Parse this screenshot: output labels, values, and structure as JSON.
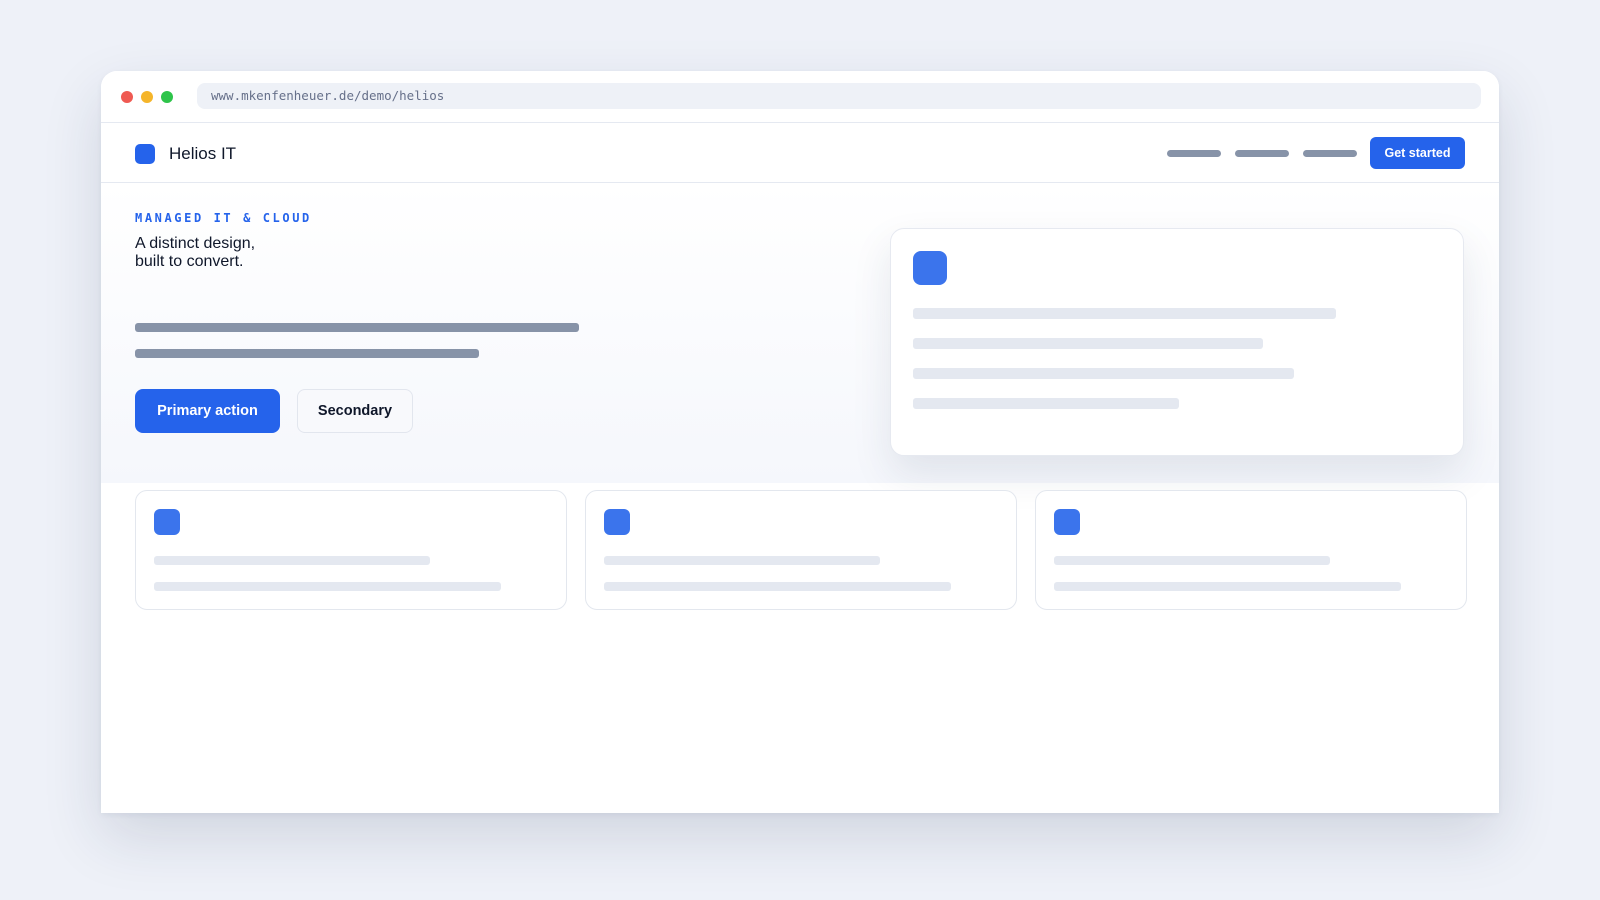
{
  "browser": {
    "url": "www.mkenfenheuer.de/demo/helios",
    "controls": [
      "close-icon",
      "minimize-icon",
      "maximize-icon"
    ]
  },
  "navbar": {
    "brand": "Helios IT",
    "cta_label": "Get started"
  },
  "hero": {
    "eyebrow": "MANAGED IT & CLOUD",
    "headline_line1": "A distinct design,",
    "headline_line2": "built to convert.",
    "primary_label": "Primary action",
    "secondary_label": "Secondary"
  },
  "colors": {
    "accent": "#2563eb",
    "icon_tile": "#3b74ec",
    "background": "#eef1f8",
    "placeholder_dark": "#8793a8",
    "placeholder_light": "#e4e8f0",
    "window_close": "#ef5a52",
    "window_minimize": "#f5b52a",
    "window_maximize": "#2ec44a"
  }
}
